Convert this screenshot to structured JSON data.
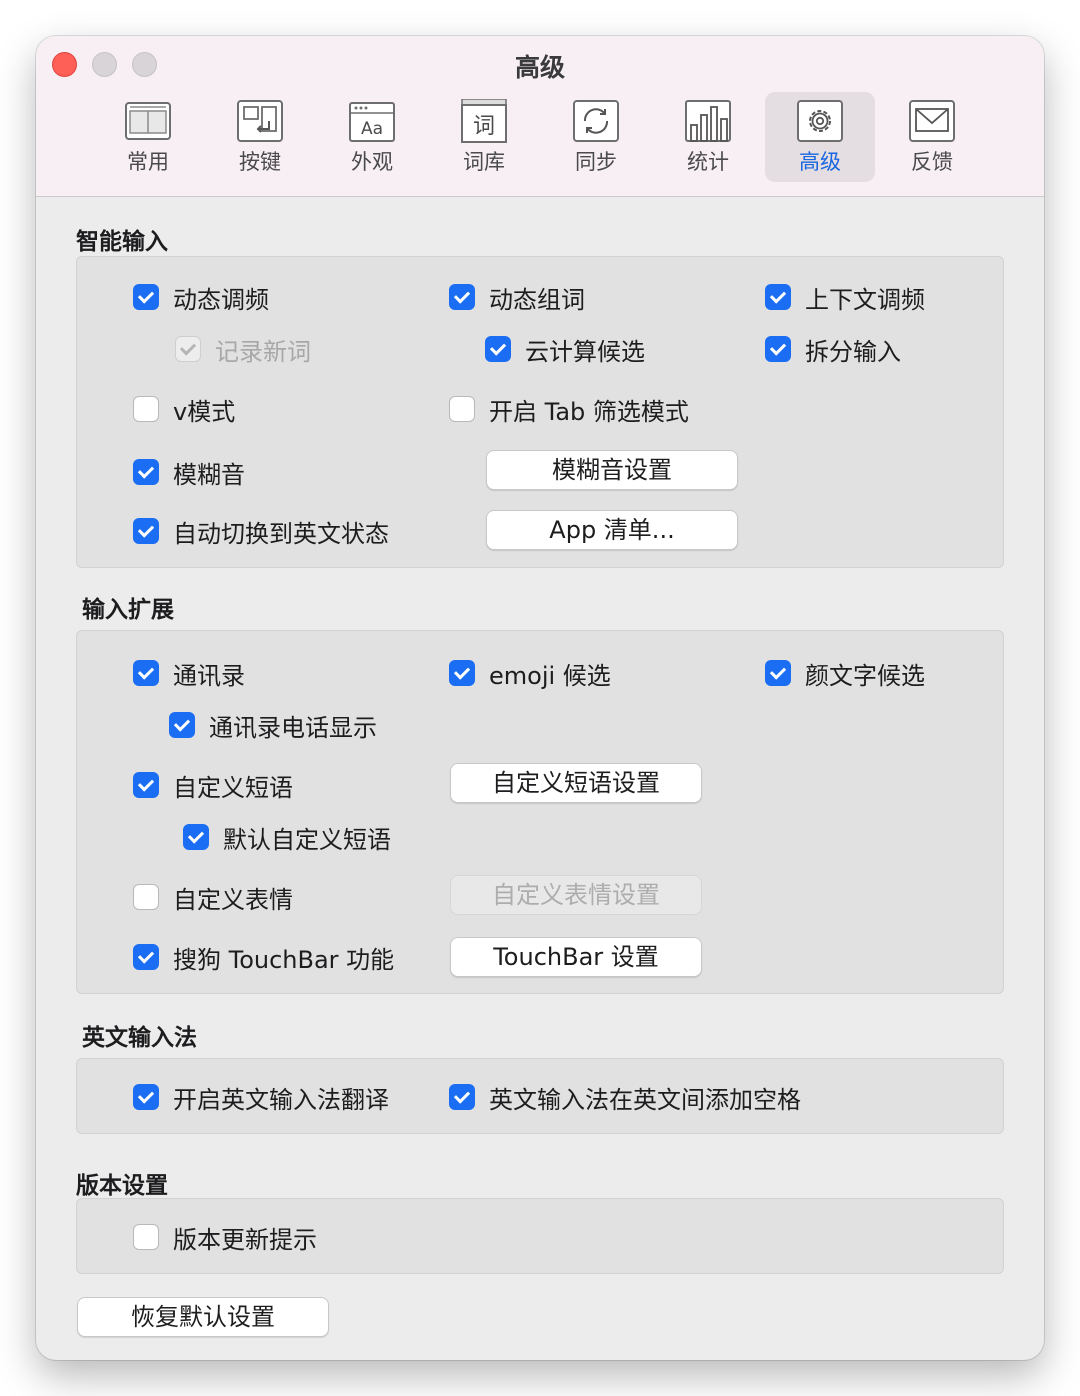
{
  "window": {
    "title": "高级"
  },
  "tabs": [
    {
      "id": "general",
      "label": "常用",
      "icon": "window-layout-icon"
    },
    {
      "id": "keys",
      "label": "按键",
      "icon": "return-key-icon"
    },
    {
      "id": "appearance",
      "label": "外观",
      "icon": "font-aa-icon",
      "icon_text": "Aa"
    },
    {
      "id": "lexicon",
      "label": "词库",
      "icon": "dictionary-icon",
      "icon_text": "词"
    },
    {
      "id": "sync",
      "label": "同步",
      "icon": "sync-arrows-icon"
    },
    {
      "id": "stats",
      "label": "统计",
      "icon": "bar-chart-icon"
    },
    {
      "id": "advanced",
      "label": "高级",
      "icon": "gear-icon",
      "active": true
    },
    {
      "id": "feedback",
      "label": "反馈",
      "icon": "envelope-icon"
    }
  ],
  "colors": {
    "accent": "#1b6ef3",
    "active_tab_label": "#1867e0",
    "close_button": "#fe5f57"
  },
  "smart_input": {
    "title": "智能输入",
    "dynamic_freq": {
      "label": "动态调频",
      "checked": true
    },
    "record_new_words": {
      "label": "记录新词",
      "checked": true,
      "disabled": true
    },
    "dynamic_phrase": {
      "label": "动态组词",
      "checked": true
    },
    "cloud_candidates": {
      "label": "云计算候选",
      "checked": true
    },
    "context_freq": {
      "label": "上下文调频",
      "checked": true
    },
    "split_input": {
      "label": "拆分输入",
      "checked": true
    },
    "v_mode": {
      "label": "v模式",
      "checked": false
    },
    "tab_filter": {
      "label": "开启 Tab 筛选模式",
      "checked": false
    },
    "fuzzy": {
      "label": "模糊音",
      "checked": true
    },
    "fuzzy_settings_button": "模糊音设置",
    "auto_english": {
      "label": "自动切换到英文状态",
      "checked": true
    },
    "app_list_button": "App 清单..."
  },
  "input_extension": {
    "title": "输入扩展",
    "contacts": {
      "label": "通讯录",
      "checked": true
    },
    "contacts_phone": {
      "label": "通讯录电话显示",
      "checked": true
    },
    "emoji": {
      "label": "emoji 候选",
      "checked": true
    },
    "kaomoji": {
      "label": "颜文字候选",
      "checked": true
    },
    "custom_phrase": {
      "label": "自定义短语",
      "checked": true
    },
    "custom_phrase_button": "自定义短语设置",
    "default_custom_phrase": {
      "label": "默认自定义短语",
      "checked": true
    },
    "custom_emoticon": {
      "label": "自定义表情",
      "checked": false
    },
    "custom_emoticon_button": "自定义表情设置",
    "touchbar": {
      "label": "搜狗 TouchBar 功能",
      "checked": true
    },
    "touchbar_button": "TouchBar 设置"
  },
  "english_input": {
    "title": "英文输入法",
    "translate": {
      "label": "开启英文输入法翻译",
      "checked": true
    },
    "add_space": {
      "label": "英文输入法在英文间添加空格",
      "checked": true
    }
  },
  "version": {
    "title": "版本设置",
    "update_prompt": {
      "label": "版本更新提示",
      "checked": false
    }
  },
  "restore_defaults_button": "恢复默认设置"
}
